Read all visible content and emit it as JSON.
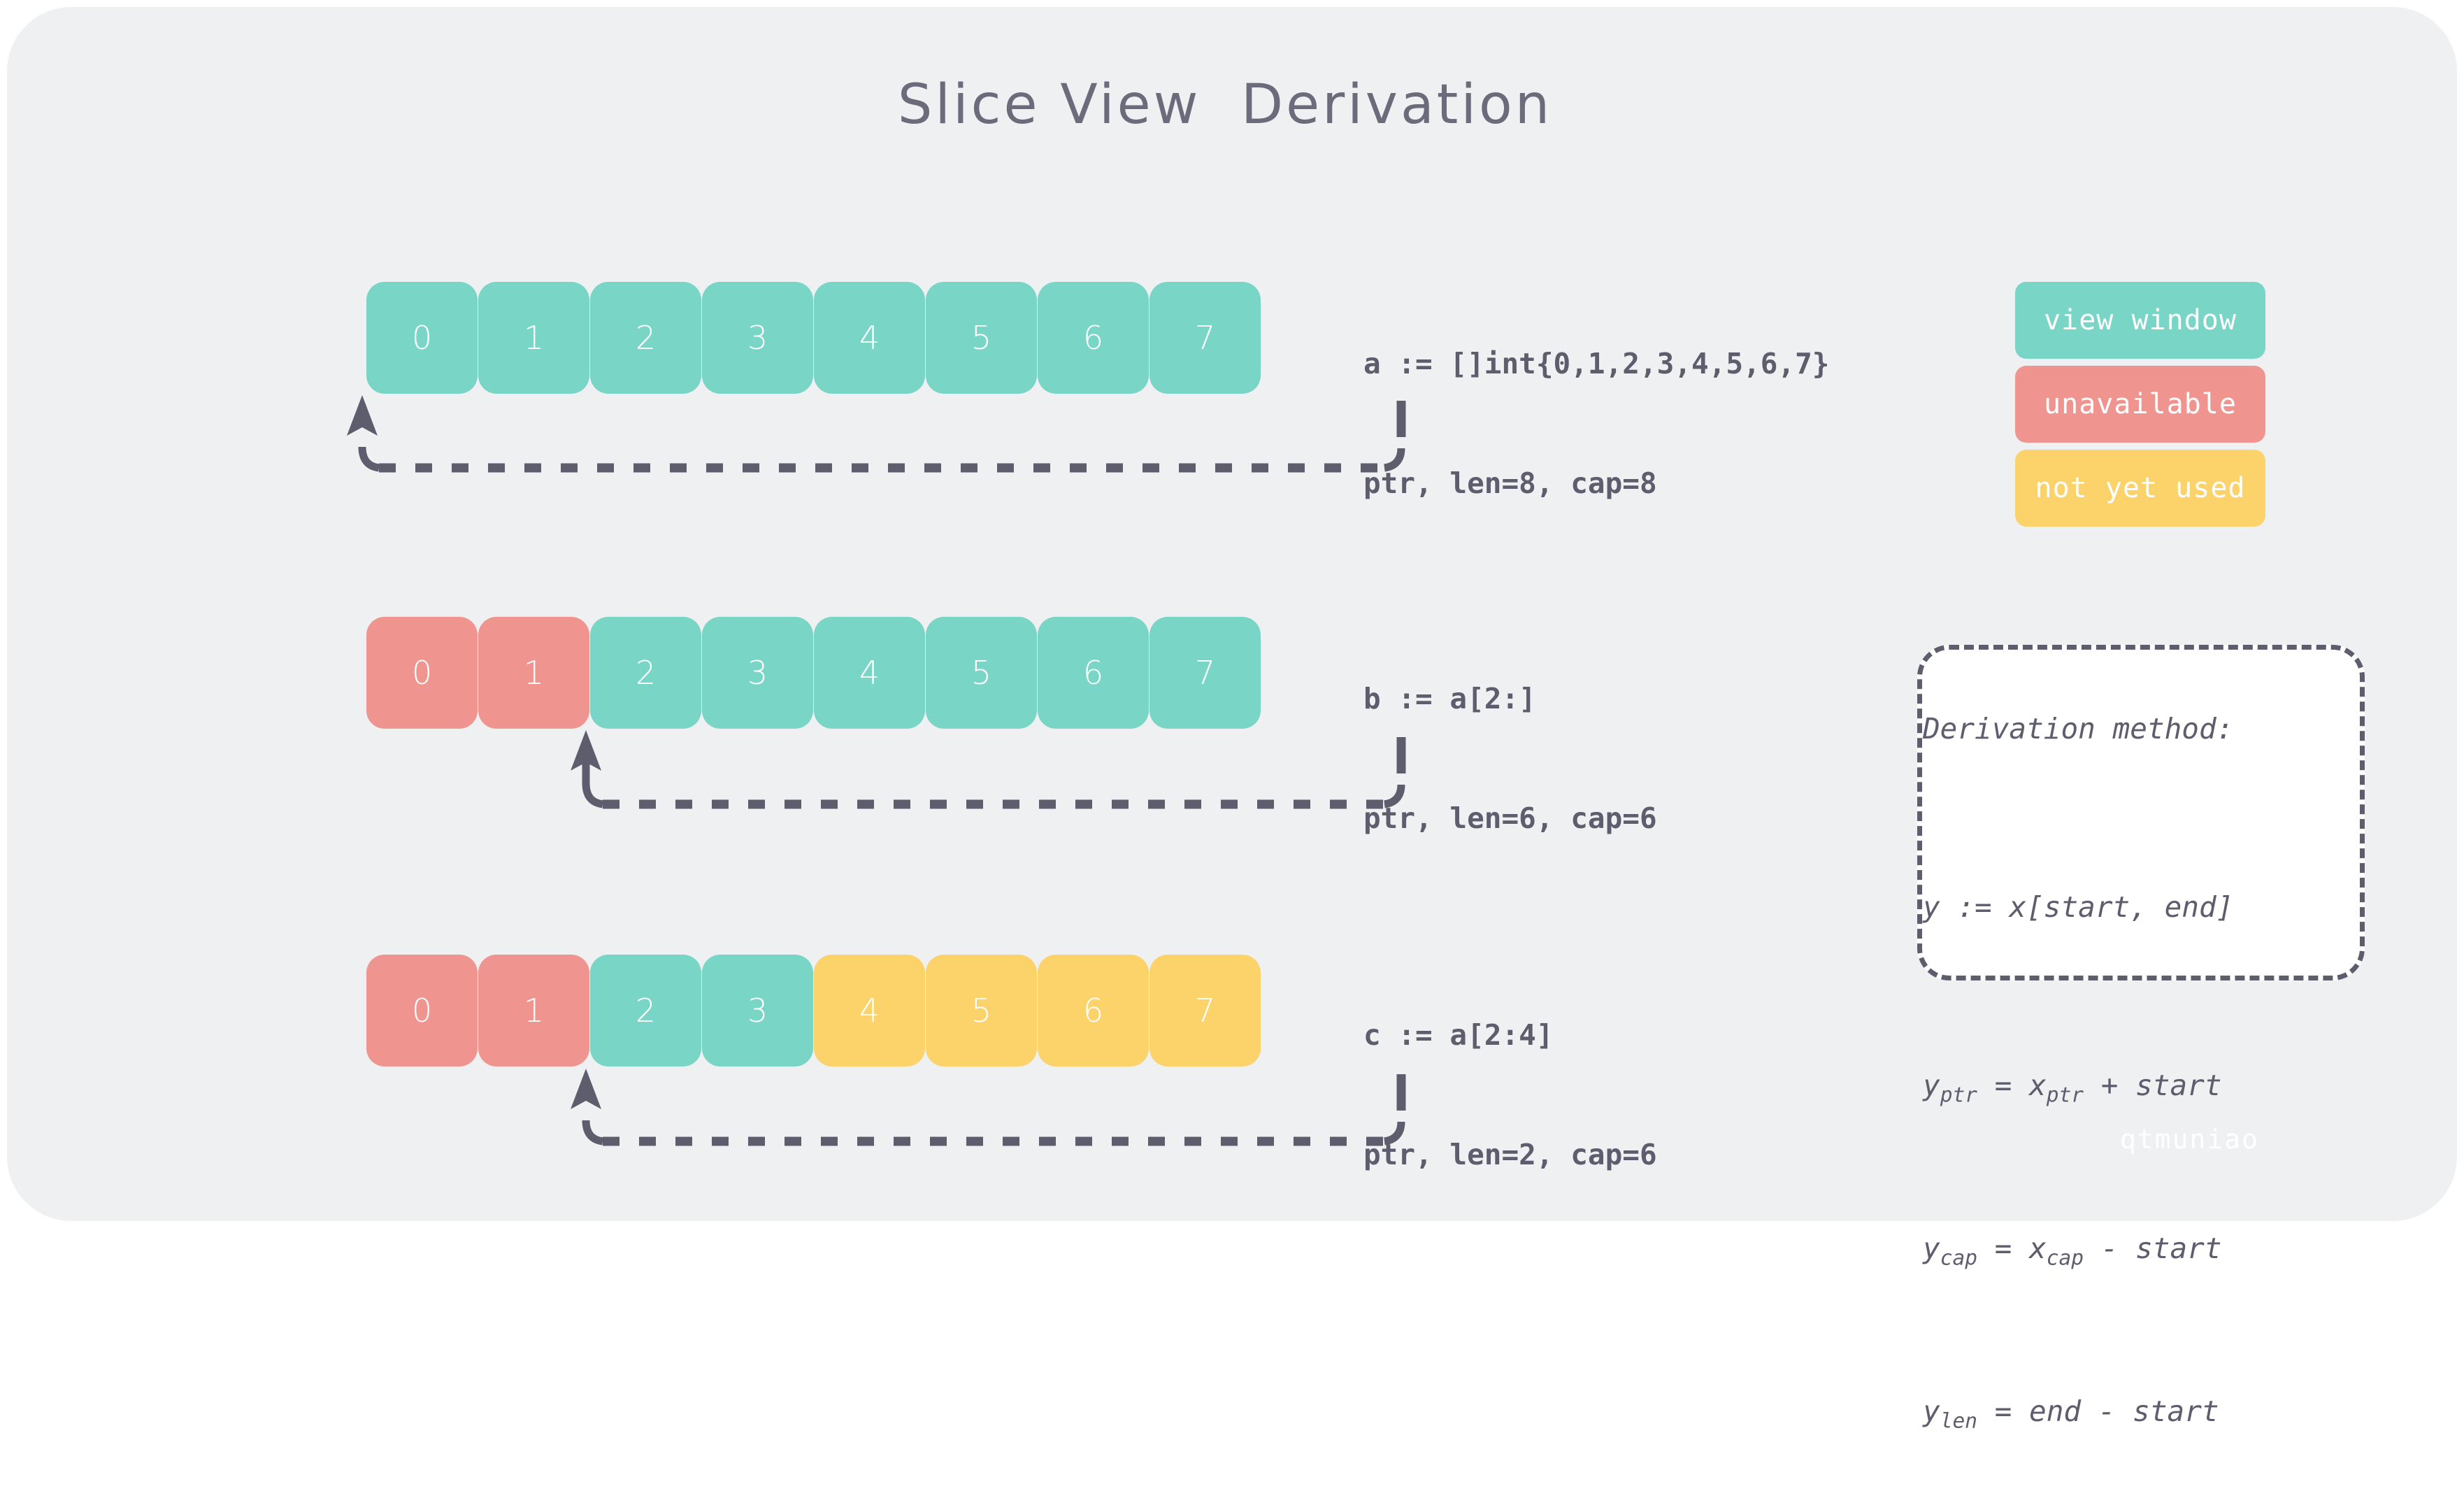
{
  "title": "Slice View  Derivation",
  "colors": {
    "card_background": "#eff0f2",
    "page_background": "#ffffff",
    "view_window": "#79d6c6",
    "unavailable": "#f0948f",
    "not_yet_used": "#fbd36a",
    "text_dark": "#5d5d6e",
    "title_text": "#6b6b7b",
    "cell_text": "#ffffff"
  },
  "rows": [
    {
      "id": "a",
      "cells": [
        {
          "value": "0",
          "state": "view window"
        },
        {
          "value": "1",
          "state": "view window"
        },
        {
          "value": "2",
          "state": "view window"
        },
        {
          "value": "3",
          "state": "view window"
        },
        {
          "value": "4",
          "state": "view window"
        },
        {
          "value": "5",
          "state": "view window"
        },
        {
          "value": "6",
          "state": "view window"
        },
        {
          "value": "7",
          "state": "view window"
        }
      ],
      "decl": "a := []int{0,1,2,3,4,5,6,7}",
      "meta": "ptr, len=8, cap=8",
      "ptr_index": 0
    },
    {
      "id": "b",
      "cells": [
        {
          "value": "0",
          "state": "unavailable"
        },
        {
          "value": "1",
          "state": "unavailable"
        },
        {
          "value": "2",
          "state": "view window"
        },
        {
          "value": "3",
          "state": "view window"
        },
        {
          "value": "4",
          "state": "view window"
        },
        {
          "value": "5",
          "state": "view window"
        },
        {
          "value": "6",
          "state": "view window"
        },
        {
          "value": "7",
          "state": "view window"
        }
      ],
      "decl": "b := a[2:]",
      "meta": "ptr, len=6, cap=6",
      "ptr_index": 2
    },
    {
      "id": "c",
      "cells": [
        {
          "value": "0",
          "state": "unavailable"
        },
        {
          "value": "1",
          "state": "unavailable"
        },
        {
          "value": "2",
          "state": "view window"
        },
        {
          "value": "3",
          "state": "view window"
        },
        {
          "value": "4",
          "state": "not yet used"
        },
        {
          "value": "5",
          "state": "not yet used"
        },
        {
          "value": "6",
          "state": "not yet used"
        },
        {
          "value": "7",
          "state": "not yet used"
        }
      ],
      "decl": "c := a[2:4]",
      "meta": "ptr, len=2, cap=6",
      "ptr_index": 2
    }
  ],
  "legend": [
    {
      "label": "view window",
      "color": "#79d6c6"
    },
    {
      "label": "unavailable",
      "color": "#f0948f"
    },
    {
      "label": "not yet used",
      "color": "#fbd36a"
    }
  ],
  "derivation": {
    "heading": "Derivation method:",
    "signature": "y := x[start, end]",
    "eq_ptr_lhs": "y",
    "eq_ptr_lhs_sub": "ptr",
    "eq_ptr_rhs_pre": " = x",
    "eq_ptr_rhs_sub": "ptr",
    "eq_ptr_rhs_post": " + start",
    "eq_cap_lhs": "y",
    "eq_cap_lhs_sub": "cap",
    "eq_cap_rhs_pre": " = x",
    "eq_cap_rhs_sub": "cap",
    "eq_cap_rhs_post": " - start",
    "eq_len_lhs": "y",
    "eq_len_lhs_sub": "len",
    "eq_len_rhs": " = end - start"
  },
  "watermark": "qtmuniao"
}
